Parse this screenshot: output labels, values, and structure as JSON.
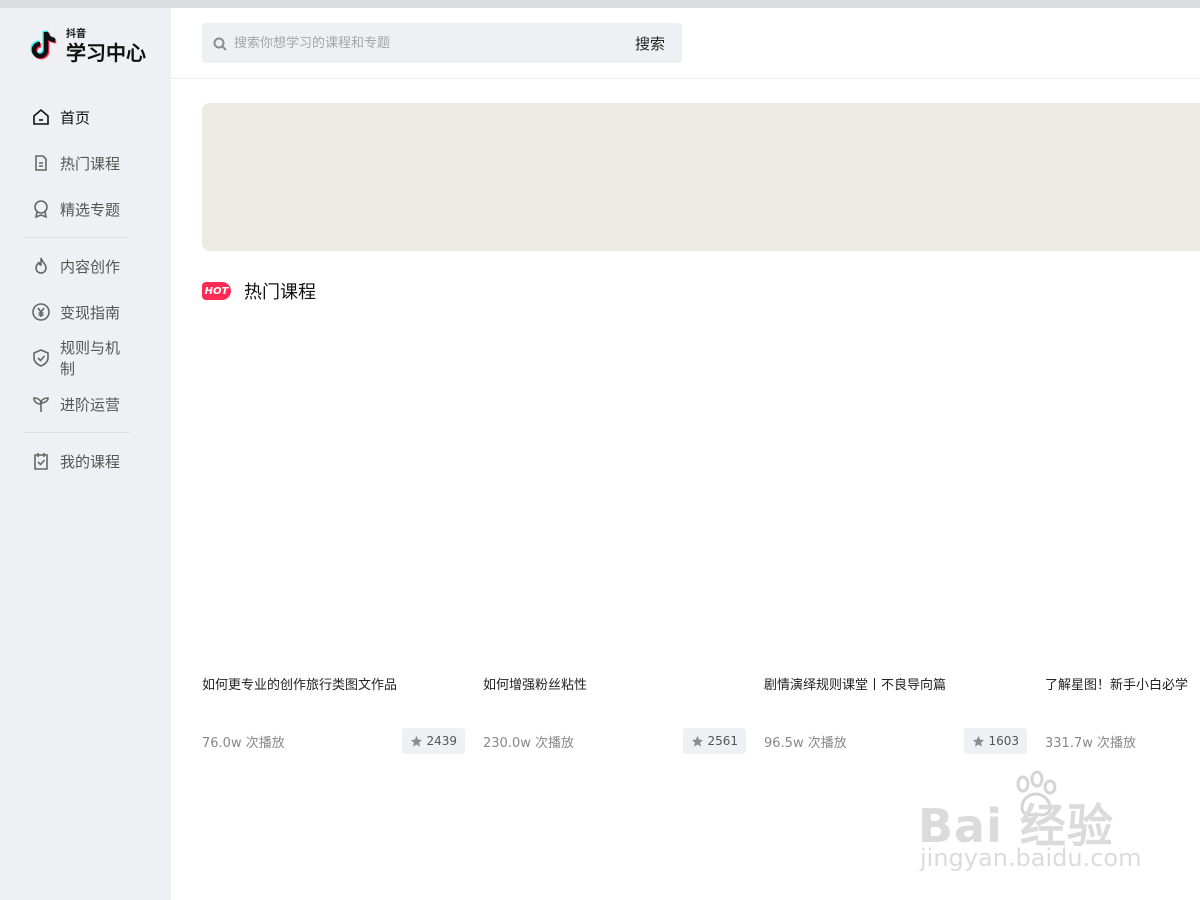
{
  "app": {
    "logo_small": "抖音",
    "logo_big": "学习中心",
    "brand_color": "#fe2c55"
  },
  "sidebar": {
    "items": [
      {
        "label": "首页",
        "icon": "home-icon",
        "active": true
      },
      {
        "label": "热门课程",
        "icon": "document-icon"
      },
      {
        "label": "精选专题",
        "icon": "badge-icon"
      },
      {
        "label": "内容创作",
        "icon": "flame-icon"
      },
      {
        "label": "变现指南",
        "icon": "yen-icon"
      },
      {
        "label": "规则与机制",
        "icon": "shield-check-icon"
      },
      {
        "label": "进阶运营",
        "icon": "sprout-icon"
      },
      {
        "label": "我的课程",
        "icon": "clipboard-check-icon"
      }
    ]
  },
  "search": {
    "placeholder": "搜索你想学习的课程和专题",
    "button": "搜索"
  },
  "section": {
    "badge": "HOT",
    "title": "热门课程"
  },
  "courses": [
    {
      "title": "如何更专业的创作旅行类图文作品",
      "plays": "76.0w 次播放",
      "favorites": "2439"
    },
    {
      "title": "如何增强粉丝粘性",
      "plays": "230.0w 次播放",
      "favorites": "2561"
    },
    {
      "title": "剧情演绎规则课堂丨不良导向篇",
      "plays": "96.5w 次播放",
      "favorites": "1603"
    },
    {
      "title": "了解星图！新手小白必学",
      "plays": "331.7w 次播放",
      "favorites": ""
    }
  ],
  "watermark": {
    "main": "Bai 经验",
    "sub": "jingyan.baidu.com"
  }
}
